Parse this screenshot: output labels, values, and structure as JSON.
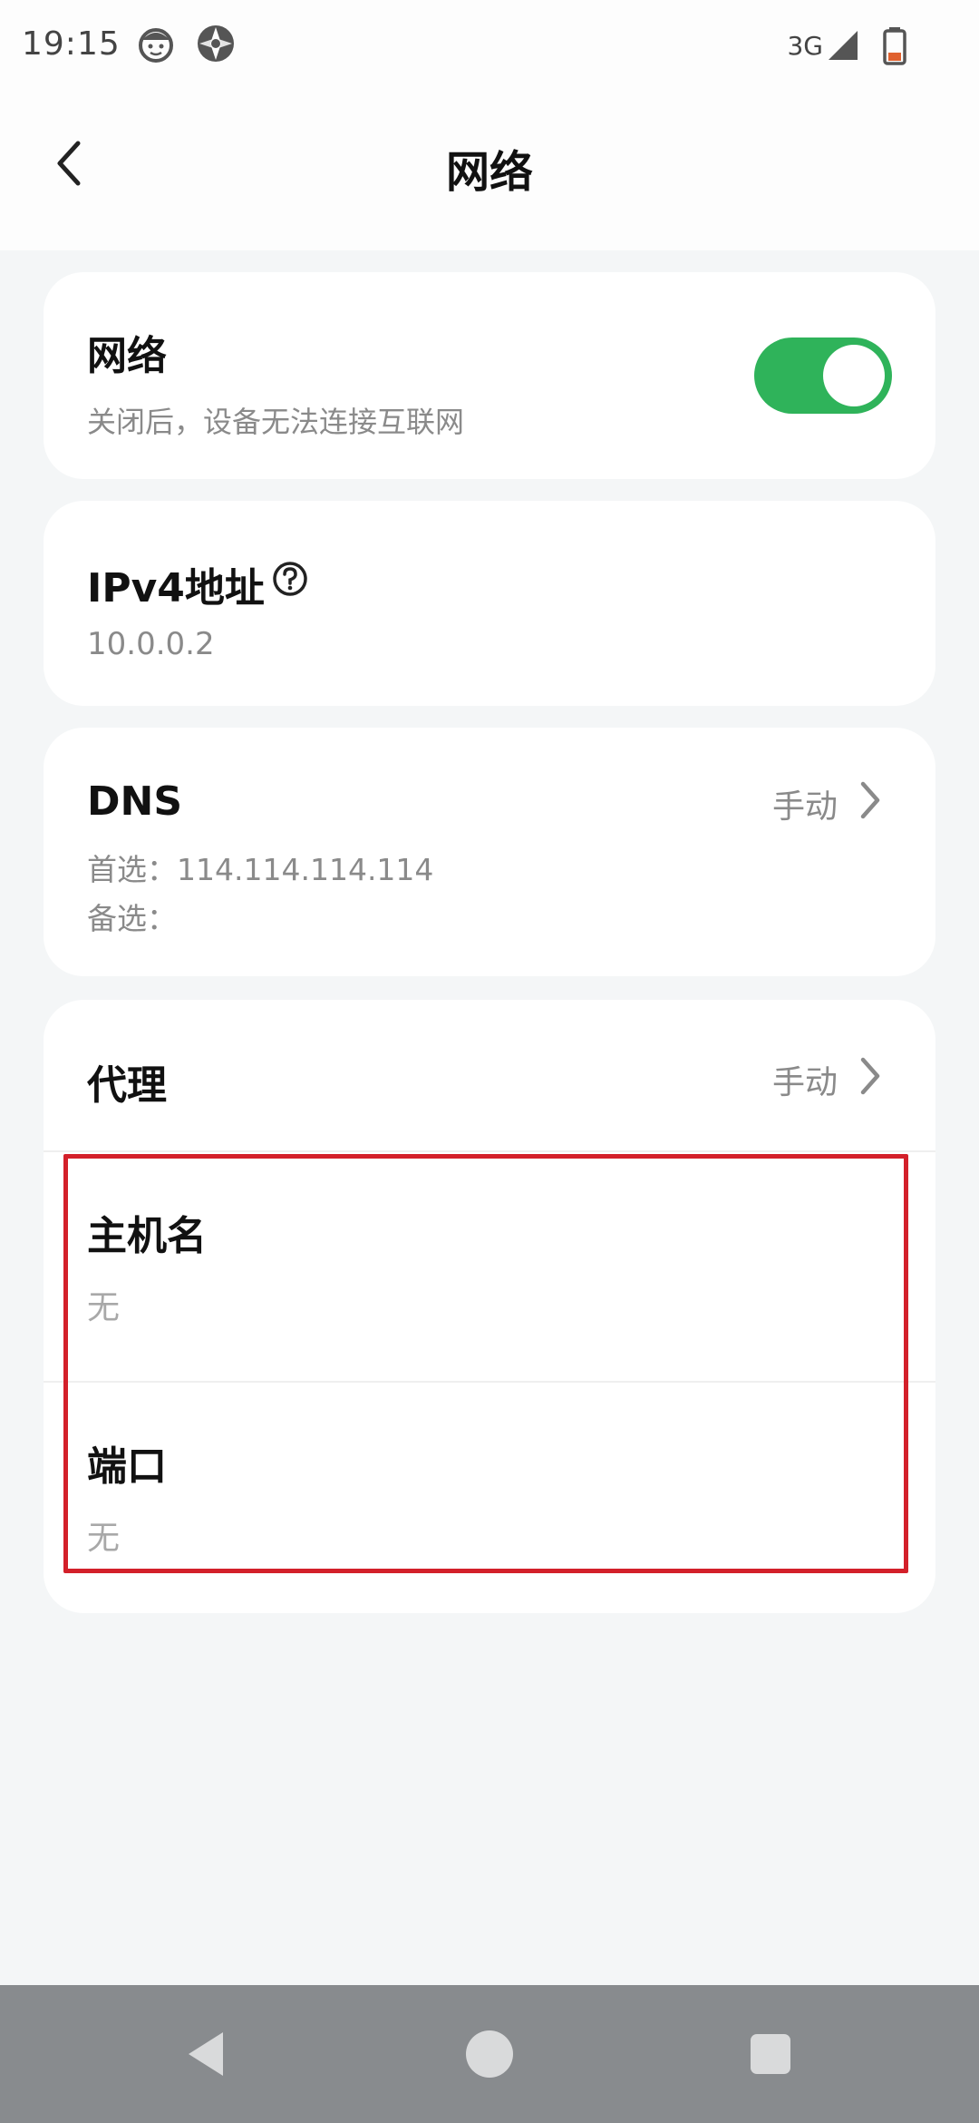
{
  "status_bar": {
    "time": "19:15",
    "network_type": "3G",
    "icons": [
      "face-notification-icon",
      "app-notification-icon",
      "signal-icon",
      "battery-icon"
    ]
  },
  "header": {
    "title": "网络",
    "back_icon": "chevron-left-icon"
  },
  "network_card": {
    "title": "网络",
    "subtitle": "关闭后，设备无法连接互联网",
    "toggle_on": true,
    "toggle_color": "#2fb35a"
  },
  "ipv4_card": {
    "title": "IPv4地址",
    "value": "10.0.0.2",
    "help_icon": "help-circle-icon"
  },
  "dns_card": {
    "title": "DNS",
    "mode": "手动",
    "primary": "首选：114.114.114.114",
    "secondary": "备选："
  },
  "proxy_card": {
    "title": "代理",
    "mode": "手动",
    "hostname_label": "主机名",
    "hostname_value": "无",
    "port_label": "端口",
    "port_value": "无",
    "highlight_color": "#d3202a"
  },
  "nav_bar": {
    "buttons": [
      "back-triangle-icon",
      "home-circle-icon",
      "recents-square-icon"
    ]
  }
}
